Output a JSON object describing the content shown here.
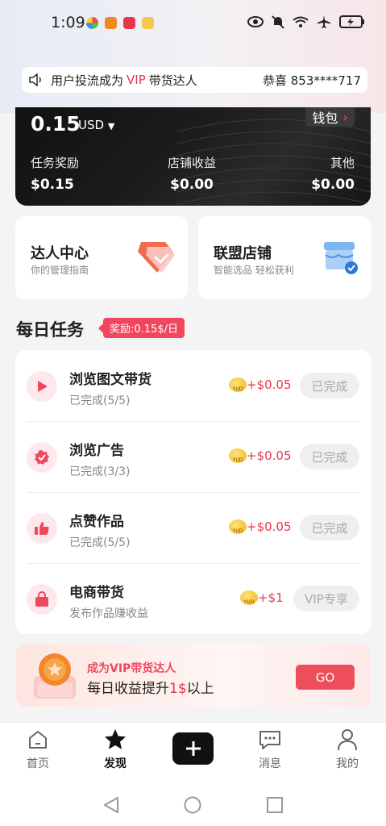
{
  "status_bar": {
    "time": "1:09"
  },
  "notice": {
    "message": "用户投流成为",
    "vip": "VIP",
    "message_tail": "带货达人",
    "congrats": "恭喜 853****717"
  },
  "wallet": {
    "balance": "0.15",
    "currency": "USD",
    "button_label": "钱包",
    "columns": [
      {
        "label": "任务奖励",
        "value": "$0.15"
      },
      {
        "label": "店铺收益",
        "value": "$0.00"
      },
      {
        "label": "其他",
        "value": "$0.00"
      }
    ]
  },
  "cards": [
    {
      "title": "达人中心",
      "subtitle": "你的管理指南"
    },
    {
      "title": "联盟店铺",
      "subtitle": "智能选品 轻松获利"
    }
  ],
  "daily_tasks": {
    "title": "每日任务",
    "reward_tag": "奖励:0.15$/日",
    "items": [
      {
        "name": "浏览图文带货",
        "status": "已完成(5/5)",
        "reward": "+$0.05",
        "state": "已完成"
      },
      {
        "name": "浏览广告",
        "status": "已完成(3/3)",
        "reward": "+$0.05",
        "state": "已完成"
      },
      {
        "name": "点赞作品",
        "status": "已完成(5/5)",
        "reward": "+$0.05",
        "state": "已完成"
      },
      {
        "name": "电商带货",
        "status": "发布作品赚收益",
        "reward": "+$1",
        "state": "VIP专享"
      }
    ],
    "coin_label": "YUD"
  },
  "vip_banner": {
    "line1": "成为VIP带货达人",
    "line2_pre": "每日收益提升",
    "line2_highlight": "1$",
    "line2_post": "以上",
    "button": "GO"
  },
  "tabbar": {
    "tabs": [
      {
        "label": "首页"
      },
      {
        "label": "发现"
      },
      {
        "label": "消息"
      },
      {
        "label": "我的"
      }
    ]
  },
  "colors": {
    "accent": "#e8364f",
    "dark_card": "#151515"
  }
}
